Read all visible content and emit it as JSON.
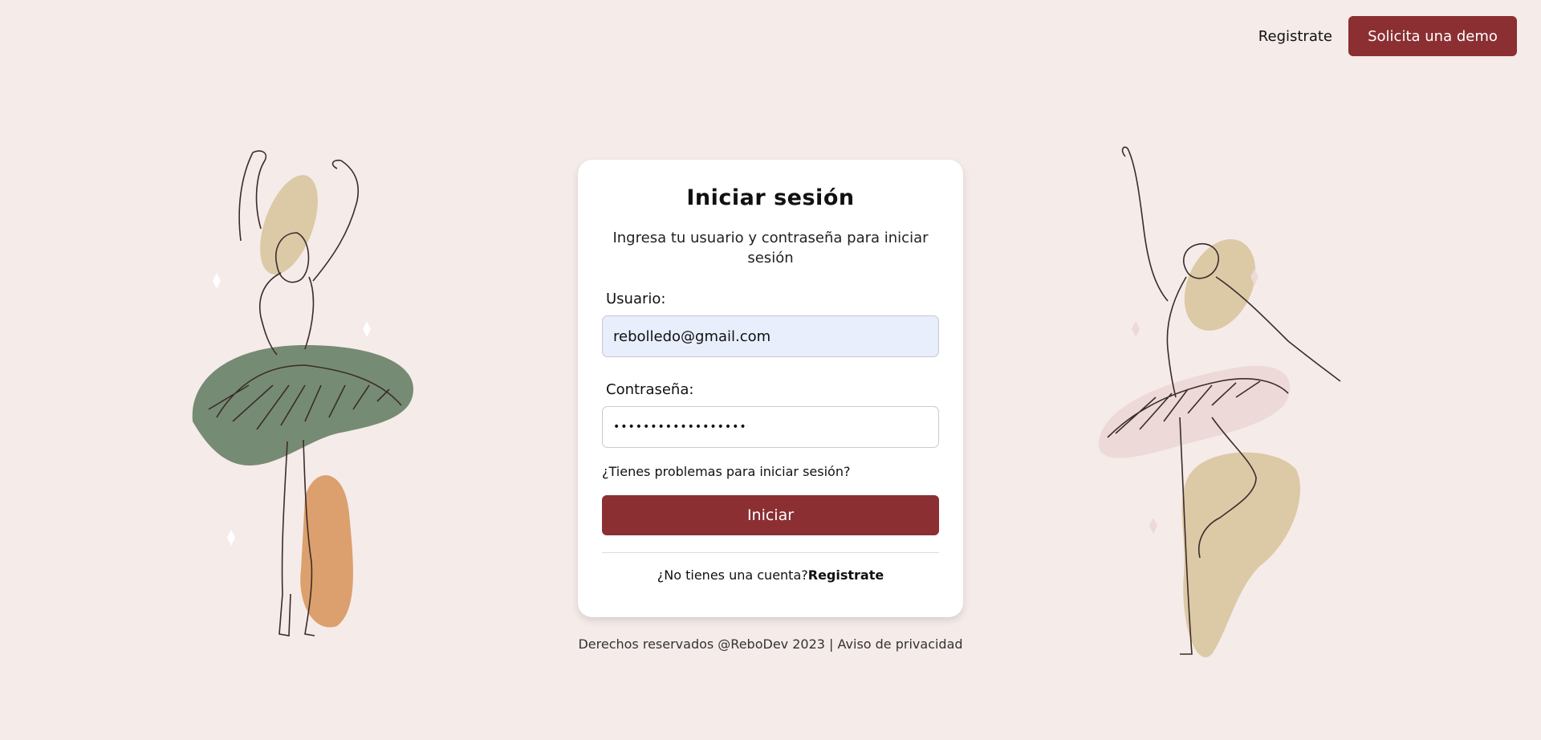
{
  "header": {
    "register_link": "Registrate",
    "demo_button": "Solicita una demo"
  },
  "login": {
    "title": "Iniciar sesión",
    "subtitle": "Ingresa tu usuario y contraseña para iniciar sesión",
    "user_label": "Usuario:",
    "user_value": "rebolledo@gmail.com",
    "password_label": "Contraseña:",
    "password_value": "••••••••••••••••••",
    "problems_link": "¿Tienes problemas para iniciar sesión?",
    "submit_button": "Iniciar",
    "no_account_text": "¿No tienes una cuenta?",
    "register_link": "Registrate"
  },
  "footer": {
    "rights": "Derechos reservados @ReboDev 2023",
    "separator": "|",
    "privacy": "Aviso de privacidad"
  },
  "colors": {
    "background": "#f5ebe9",
    "accent": "#8b2f33",
    "input_filled": "#e8eefb",
    "tutu_green": "#768b73",
    "beige": "#dcc9a6",
    "orange": "#dba06d",
    "pink": "#ecd9d8"
  }
}
